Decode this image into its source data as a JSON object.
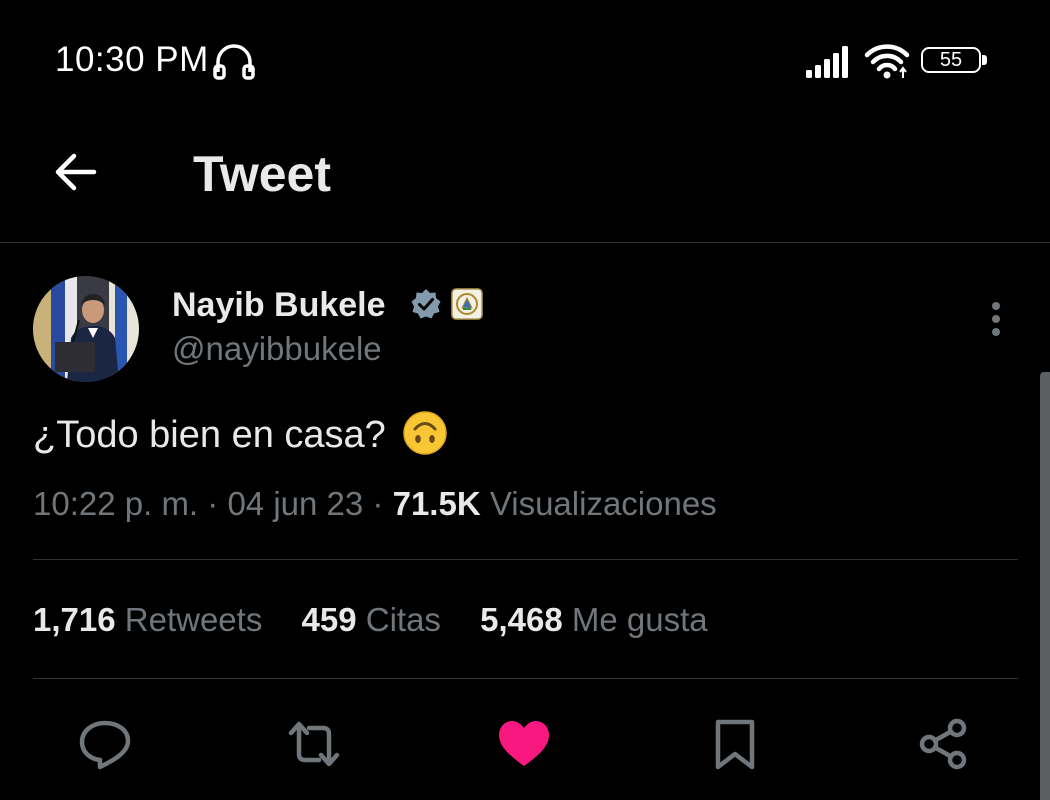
{
  "status_bar": {
    "time": "10:30 PM",
    "battery": "55",
    "icons": [
      "headset-icon",
      "signal-icon",
      "wifi-icon",
      "battery-icon"
    ]
  },
  "header": {
    "title": "Tweet",
    "back_icon": "back-arrow-icon"
  },
  "tweet": {
    "author_name": "Nayib Bukele",
    "handle": "@nayibbukele",
    "text": "¿Todo bien en casa?",
    "emoji": "upside-down-face",
    "time": "10:22 p. m.",
    "separator": "·",
    "date": "04 jun 23",
    "views_count": "71.5K",
    "views_label": "Visualizaciones"
  },
  "stats": {
    "retweets_count": "1,716",
    "retweets_label": "Retweets",
    "quotes_count": "459",
    "quotes_label": "Citas",
    "likes_count": "5,468",
    "likes_label": "Me gusta"
  },
  "actions": [
    "reply-icon",
    "retweet-icon",
    "like-icon",
    "bookmark-icon",
    "share-icon"
  ],
  "colors": {
    "background": "#000000",
    "primary_text": "#e7e9ea",
    "secondary_text": "#71767b",
    "divider": "#2f3336",
    "like_active": "#f91880",
    "verified": "#829aab"
  }
}
